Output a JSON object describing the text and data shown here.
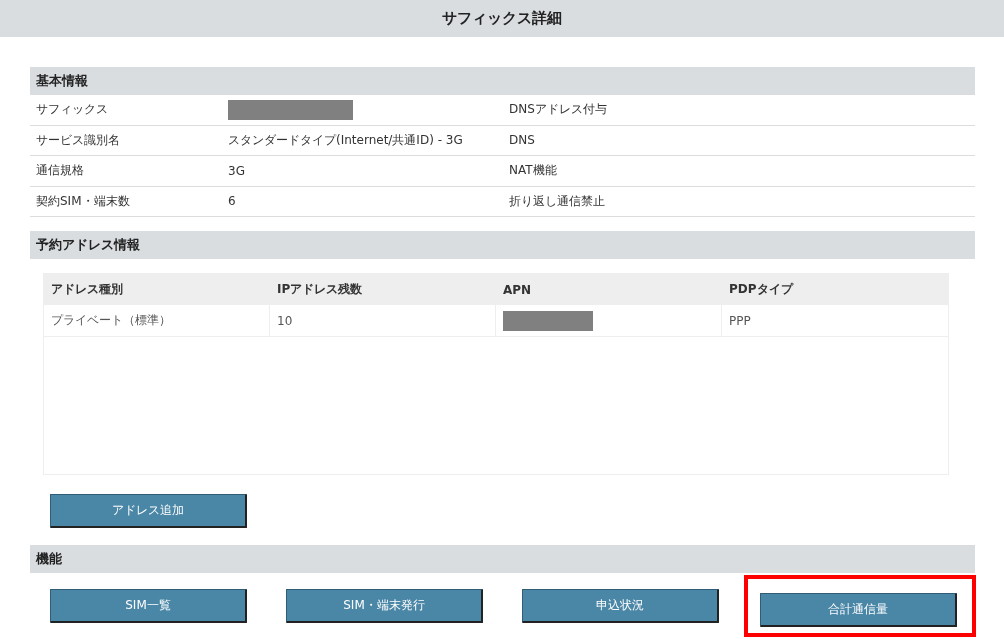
{
  "page_title": "サフィックス詳細",
  "basic_info": {
    "title": "基本情報",
    "rows": [
      {
        "label": "サフィックス",
        "value": "",
        "redacted": true,
        "label_2": "DNSアドレス付与"
      },
      {
        "label": "サービス識別名",
        "value": "スタンダードタイプ(Internet/共通ID) - 3G",
        "redacted": false,
        "label_2": "DNS"
      },
      {
        "label": "通信規格",
        "value": "3G",
        "redacted": false,
        "label_2": "NAT機能"
      },
      {
        "label": "契約SIM・端末数",
        "value": "6",
        "redacted": false,
        "label_2": "折り返し通信禁止"
      }
    ]
  },
  "reserved_address": {
    "title": "予約アドレス情報",
    "columns": [
      "アドレス種別",
      "IPアドレス残数",
      "APN",
      "PDPタイプ"
    ],
    "rows": [
      {
        "cells": [
          {
            "text": "プライベート（標準）",
            "redacted": false
          },
          {
            "text": "10",
            "redacted": false
          },
          {
            "text": "",
            "redacted": true
          },
          {
            "text": "PPP",
            "redacted": false
          }
        ]
      }
    ],
    "add_button": "アドレス追加"
  },
  "functions": {
    "title": "機能",
    "buttons": [
      {
        "label": "SIM一覧",
        "highlighted": false
      },
      {
        "label": "SIM・端末発行",
        "highlighted": false
      },
      {
        "label": "申込状況",
        "highlighted": false
      },
      {
        "label": "合計通信量",
        "highlighted": true
      }
    ]
  }
}
